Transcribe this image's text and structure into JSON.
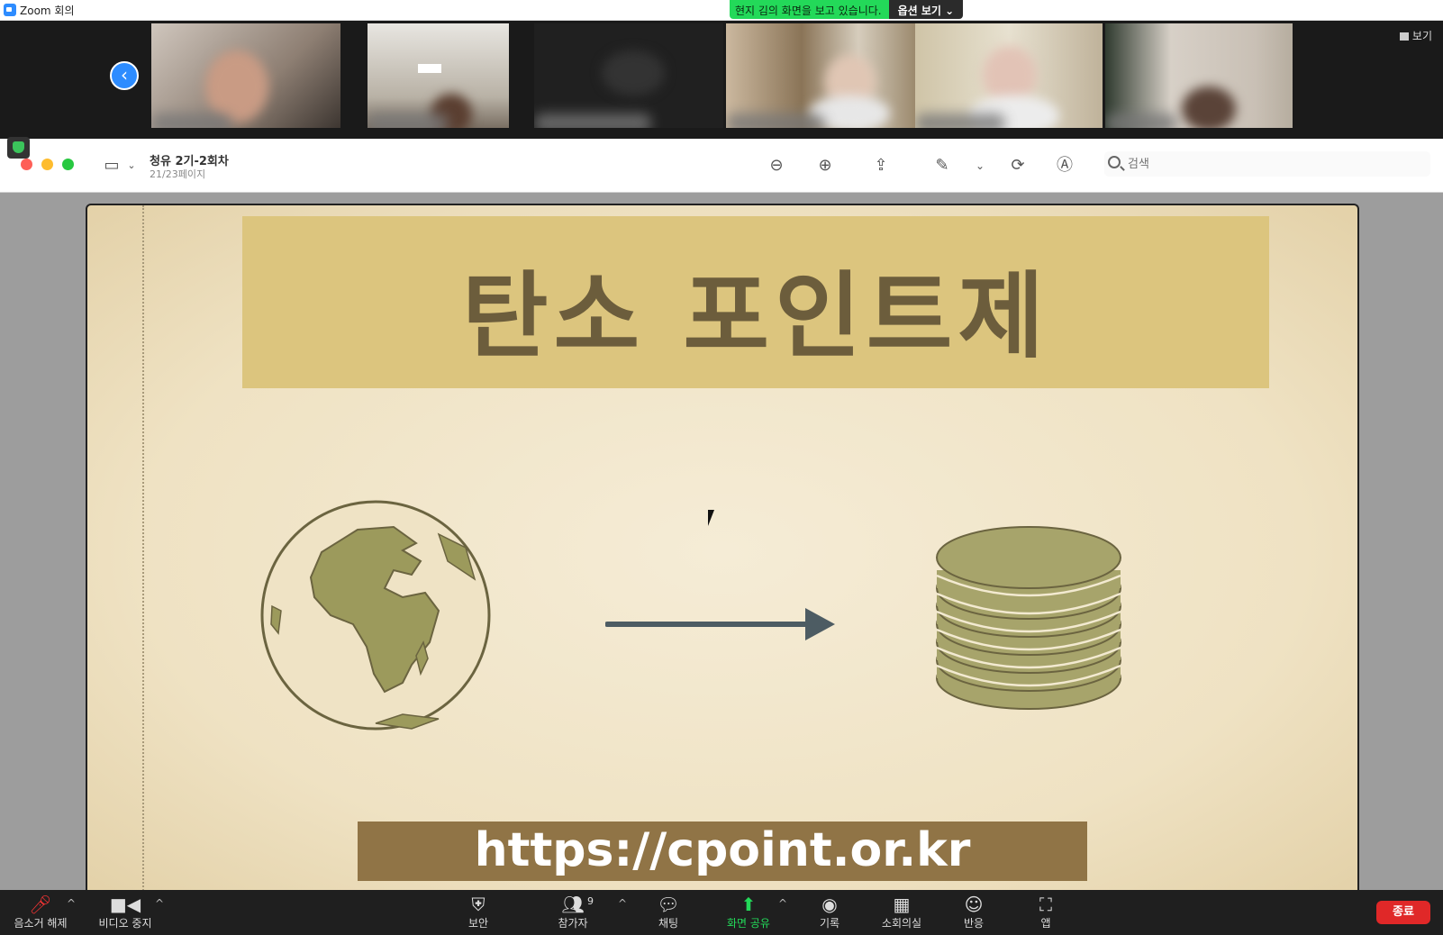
{
  "window": {
    "title": "Zoom 회의"
  },
  "share_banner": {
    "message": "현지 김의 화면을 보고 있습니다.",
    "options_label": "옵션 보기 ⌄"
  },
  "gallery": {
    "view_label": "보기"
  },
  "viewer": {
    "doc_title": "청유 2기-2회차",
    "page_info": "21/23페이지",
    "search_placeholder": "검색"
  },
  "slide": {
    "title": "탄소 포인트제",
    "url": "https://cpoint.or.kr"
  },
  "toolbar": {
    "mute_label": "음소거 해제",
    "video_label": "비디오 중지",
    "security_label": "보안",
    "participants_label": "참가자",
    "participants_count": "9",
    "chat_label": "채팅",
    "share_label": "화면 공유",
    "record_label": "기록",
    "breakout_label": "소회의실",
    "reactions_label": "반응",
    "apps_label": "앱",
    "end_label": "종료"
  },
  "colors": {
    "accent": "#2d8cff",
    "share_green": "#23d959",
    "end_red": "#e02828",
    "slide_banner": "#dcc57e",
    "slide_text": "#6c5d3c",
    "url_bar": "#907446"
  }
}
